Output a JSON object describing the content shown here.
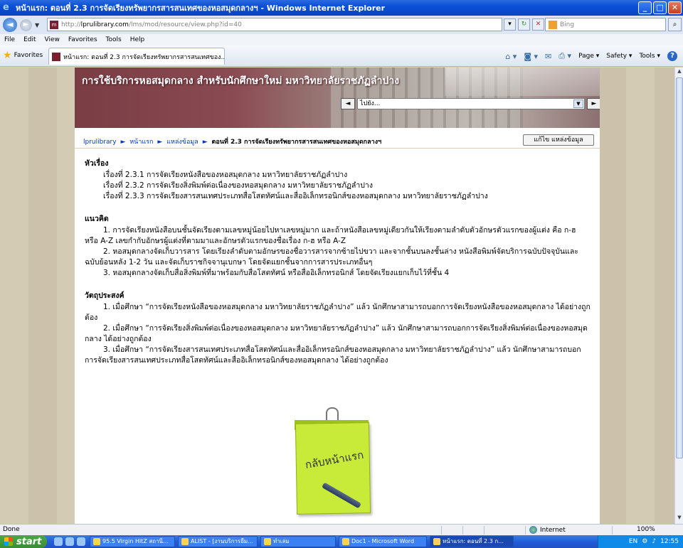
{
  "window": {
    "title": "หน้าแรก: ตอนที่ 2.3 การจัดเรียงทรัพยากรสารสนเทศของหอสมุดกลางฯ - Windows Internet Explorer",
    "min": "_",
    "max": "□",
    "close": "✕"
  },
  "address": {
    "url_prefix": "http://",
    "url_host": "lprulibrary.com",
    "url_path": "/lms/mod/resource/view.php?id=40",
    "search_placeholder": "Bing"
  },
  "menu": [
    "File",
    "Edit",
    "View",
    "Favorites",
    "Tools",
    "Help"
  ],
  "favorites": {
    "label": "Favorites",
    "tab_title": "หน้าแรก: ตอนที่ 2.3 การจัดเรียงทรัพยากรสารสนเทศของ...",
    "page_label": "Page ▾",
    "safety_label": "Safety ▾",
    "tools_label": "Tools ▾"
  },
  "banner": {
    "title": "การใช้บริการหอสมุดกลาง สำหรับนักศึกษาใหม่ มหาวิทยาลัยราชภัฏลำปาง",
    "jump_placeholder": "ไปยัง...",
    "prev": "◄",
    "next": "►"
  },
  "breadcrumb": {
    "items": [
      "lprulibrary",
      "หน้าแรก",
      "แหล่งข้อมูล"
    ],
    "current": "ตอนที่ 2.3 การจัดเรียงทรัพยากรสารสนเทศของหอสมุดกลางฯ",
    "separator": "►"
  },
  "edit_button": "แก้ไข แหล่งข้อมูล",
  "topics": {
    "heading": "หัวเรื่อง",
    "items": [
      "เรื่องที่ 2.3.1 การจัดเรียงหนังสือของหอสมุดกลาง มหาวิทยาลัยราชภัฏลำปาง",
      "เรื่องที่ 2.3.2 การจัดเรียงสิ่งพิมพ์ต่อเนื่องของหอสมุดกลาง มหาวิทยาลัยราชภัฏลำปาง",
      "เรื่องที่ 2.3.3 การจัดเรียงสารสนเทศประเภทสื่อโสตทัศน์และสื่ออิเล็กทรอนิกส์ของหอสมุดกลาง มหาวิทยาลัยราชภัฏลำปาง"
    ]
  },
  "concepts": {
    "heading": "แนวคิด",
    "items": [
      "1. การจัดเรียงหนังสือบนชั้นจัดเรียงตามเลขหมู่น้อยไปหาเลขหมู่มาก และถ้าหนังสือเลขหมู่เดียวกันให้เรียงตามลำดับตัวอักษรตัวแรกของผู้แต่ง คือ ก-ฮ หรือ A-Z เลขกำกับอักษรผู้แต่งที่ตามมาและอักษรตัวแรกของชื่อเรื่อง ก-ฮ หรือ A-Z",
      "2. หอสมุดกลางจัดเก็บวารสาร โดยเรียงลำดับตามอักษรของชื่อวารสารจากซ้ายไปขวา และจากชั้นบนลงชั้นล่าง หนังสือพิมพ์จัดบริการฉบับปัจจุบันและฉบับย้อนหลัง 1-2 วัน และจัดเก็บราชกิจจานุเบกษา โดยจัดแยกชั้นจากการสารประเภทอื่นๆ",
      "3. หอสมุดกลางจัดเก็บสื่อสิ่งพิมพ์ที่มาพร้อมกับสื่อโสตทัศน์ หรือสื่ออิเล็กทรอนิกส์ โดยจัดเรียงแยกเก็บไว้ที่ชั้น 4"
    ]
  },
  "objectives": {
    "heading": "วัตถุประสงค์",
    "items": [
      "1. เมื่อศึกษา “การจัดเรียงหนังสือของหอสมุดกลาง มหาวิทยาลัยราชภัฏลำปาง” แล้ว นักศึกษาสามารถบอกการจัดเรียงหนังสือของหอสมุดกลาง ได้อย่างถูกต้อง",
      "2. เมื่อศึกษา “การจัดเรียงสิ่งพิมพ์ต่อเนื่องของหอสมุดกลาง มหาวิทยาลัยราชภัฏลำปาง” แล้ว นักศึกษาสามารถบอกการจัดเรียงสิ่งพิมพ์ต่อเนื่องของหอสมุดกลาง ได้อย่างถูกต้อง",
      "3. เมื่อศึกษา “การจัดเรียงสารสนเทศประเภทสื่อโสตทัศน์และสื่ออิเล็กทรอนิกส์ของหอสมุดกลาง มหาวิทยาลัยราชภัฏลำปาง” แล้ว นักศึกษาสามารถบอกการจัดเรียงสารสนเทศประเภทสื่อโสตทัศน์และสื่ออิเล็กทรอนิกส์ของหอสมุดกลาง ได้อย่างถูกต้อง"
    ]
  },
  "home_note": "กลับหน้าแรก",
  "status": {
    "left": "Done",
    "zone": "Internet",
    "zoom": "100%"
  },
  "taskbar": {
    "start": "start",
    "buttons": [
      "95.5 Virgin HitZ สถานี...",
      "ALIST - [งานบริการยืม...",
      "ทำเล่ม",
      "Doc1 - Microsoft Word",
      "หน้าแรก: ตอนที่ 2.3 ก..."
    ],
    "lang": "EN",
    "clock": "12:55"
  }
}
